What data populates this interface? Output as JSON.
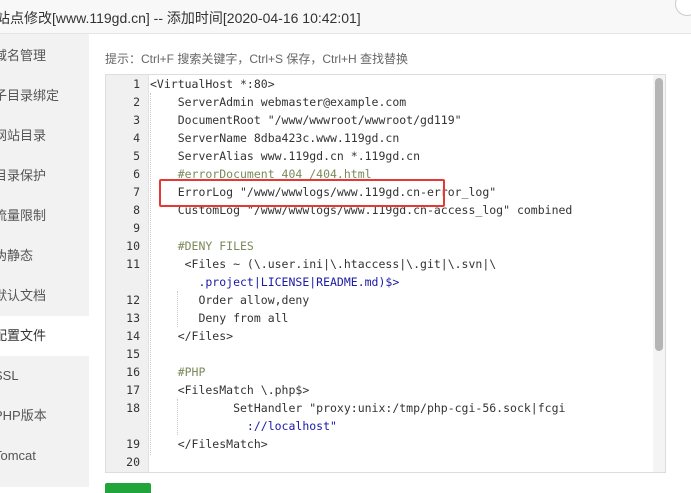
{
  "window": {
    "title": "站点修改[www.119gd.cn] -- 添加时间[2020-04-16 10:42:01]"
  },
  "sidebar": {
    "items": [
      {
        "label": "域名管理"
      },
      {
        "label": "子目录绑定"
      },
      {
        "label": "网站目录"
      },
      {
        "label": "目录保护"
      },
      {
        "label": "流量限制"
      },
      {
        "label": "伪静态"
      },
      {
        "label": "默认文档"
      },
      {
        "label": "配置文件",
        "active": true
      },
      {
        "label": "SSL"
      },
      {
        "label": "PHP版本"
      },
      {
        "label": "Tomcat"
      }
    ]
  },
  "main": {
    "tips": "提示：Ctrl+F 搜索关键字，Ctrl+S 保存，Ctrl+H 查找替换"
  },
  "editor": {
    "line_numbers": [
      "1",
      "2",
      "3",
      "4",
      "5",
      "6",
      "7",
      "8",
      "9",
      "10",
      "11",
      "",
      "12",
      "13",
      "14",
      "15",
      "16",
      "17",
      "18",
      "",
      "19",
      "20"
    ],
    "lines": [
      "<VirtualHost *:80>",
      "    ServerAdmin webmaster@example.com",
      "    DocumentRoot \"/www/wwwroot/wwwroot/gd119\"",
      "    ServerName 8dba423c.www.119gd.cn",
      "    ServerAlias www.119gd.cn *.119gd.cn",
      "    #errorDocument 404 /404.html",
      "    ErrorLog \"/www/wwwlogs/www.119gd.cn-error_log\"",
      "    CustomLog \"/www/wwwlogs/www.119gd.cn-access_log\" combined",
      "",
      "    #DENY FILES",
      "     <Files ~ (\\.user.ini|\\.htaccess|\\.git|\\.svn|\\",
      "       .project|LICENSE|README.md)$>",
      "       Order allow,deny",
      "       Deny from all",
      "    </Files>",
      "",
      "    #PHP",
      "    <FilesMatch \\.php$>",
      "            SetHandler \"proxy:unix:/tmp/php-cgi-56.sock|fcgi",
      "              ://localhost\"",
      "    </FilesMatch>",
      ""
    ]
  },
  "colors": {
    "highlight": "#e53935",
    "save_button": "#20a53a",
    "string": "#1a1aa6"
  }
}
